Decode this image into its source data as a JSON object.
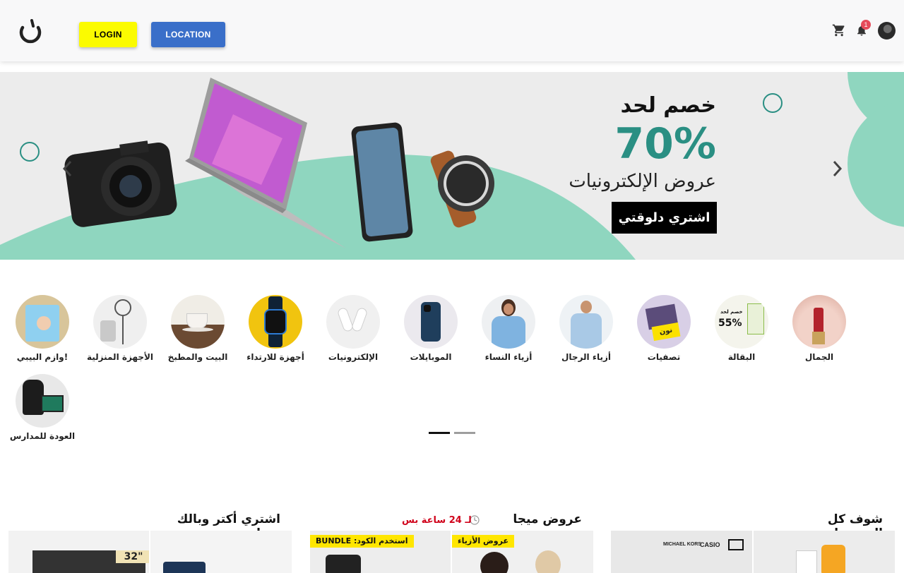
{
  "header": {
    "login_label": "LOGIN",
    "location_label": "LOCATION",
    "notification_count": "1",
    "icons": [
      "noon-logo-icon",
      "cart-icon",
      "bell-icon",
      "avatar"
    ]
  },
  "hero": {
    "line1": "خصم لحد",
    "line2": "70%",
    "line3": "عروض الإلكترونيات",
    "cta": "اشتري دلوقتي",
    "accent_color": "#8fd6bf"
  },
  "categories": [
    {
      "label": "الجمال"
    },
    {
      "label": "البقالة"
    },
    {
      "label": "تصفيات"
    },
    {
      "label": "أزياء الرجال"
    },
    {
      "label": "أزياء النساء"
    },
    {
      "label": "الموبايلات"
    },
    {
      "label": "الإلكترونيات"
    },
    {
      "label": "أجهزة للارتداء"
    },
    {
      "label": "البيت والمطبخ"
    },
    {
      "label": "الأجهزة المنزلية"
    },
    {
      "label": "!وازم البيبي"
    },
    {
      "label": "العودة للمدارس"
    }
  ],
  "category_tiles": {
    "groceries_promo": "خصم لحد",
    "groceries_value": "55%",
    "clearance_promo": "نون"
  },
  "sections": {
    "buy_more": "اشتري أكتر وبالك مرتاح",
    "mega_deals": "عروض ميجا يومية",
    "mega_timer": "لـ 24 ساعة بس",
    "all_discounts": "شوف كل الخصومات"
  },
  "tiles": {
    "tv_size": "32\"",
    "bundle_tag": "استخدم الكود: BUNDLE",
    "fashion_tag": "عروض الأزياء",
    "brand_text": "MICHAEL KORS",
    "brand_text2": "CASIO"
  },
  "colors": {
    "login_bg": "#fbfb00",
    "location_bg": "#3a6fc9",
    "badge": "#e64a5a",
    "active_dot": "#111111",
    "inactive_dot": "#9e9e9e"
  }
}
